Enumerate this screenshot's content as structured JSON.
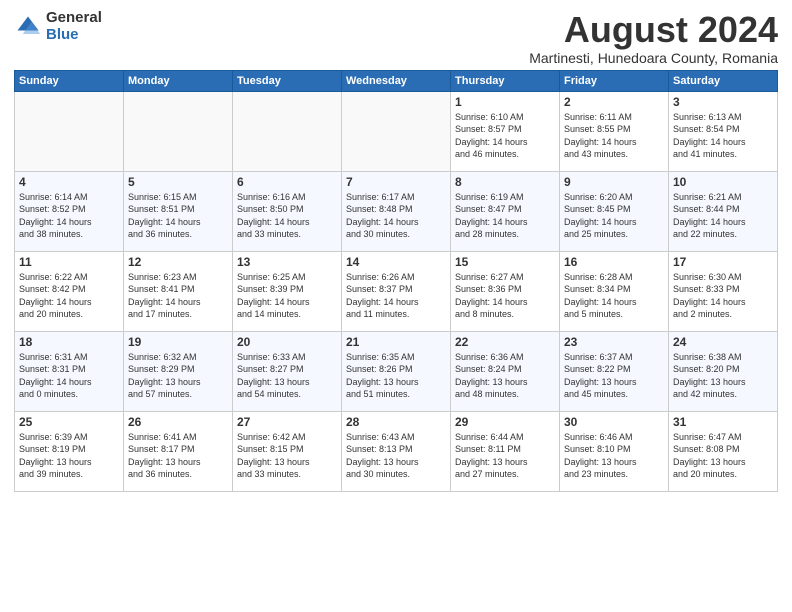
{
  "header": {
    "logo_general": "General",
    "logo_blue": "Blue",
    "title": "August 2024",
    "location": "Martinesti, Hunedoara County, Romania"
  },
  "weekdays": [
    "Sunday",
    "Monday",
    "Tuesday",
    "Wednesday",
    "Thursday",
    "Friday",
    "Saturday"
  ],
  "weeks": [
    [
      {
        "day": "",
        "detail": ""
      },
      {
        "day": "",
        "detail": ""
      },
      {
        "day": "",
        "detail": ""
      },
      {
        "day": "",
        "detail": ""
      },
      {
        "day": "1",
        "detail": "Sunrise: 6:10 AM\nSunset: 8:57 PM\nDaylight: 14 hours\nand 46 minutes."
      },
      {
        "day": "2",
        "detail": "Sunrise: 6:11 AM\nSunset: 8:55 PM\nDaylight: 14 hours\nand 43 minutes."
      },
      {
        "day": "3",
        "detail": "Sunrise: 6:13 AM\nSunset: 8:54 PM\nDaylight: 14 hours\nand 41 minutes."
      }
    ],
    [
      {
        "day": "4",
        "detail": "Sunrise: 6:14 AM\nSunset: 8:52 PM\nDaylight: 14 hours\nand 38 minutes."
      },
      {
        "day": "5",
        "detail": "Sunrise: 6:15 AM\nSunset: 8:51 PM\nDaylight: 14 hours\nand 36 minutes."
      },
      {
        "day": "6",
        "detail": "Sunrise: 6:16 AM\nSunset: 8:50 PM\nDaylight: 14 hours\nand 33 minutes."
      },
      {
        "day": "7",
        "detail": "Sunrise: 6:17 AM\nSunset: 8:48 PM\nDaylight: 14 hours\nand 30 minutes."
      },
      {
        "day": "8",
        "detail": "Sunrise: 6:19 AM\nSunset: 8:47 PM\nDaylight: 14 hours\nand 28 minutes."
      },
      {
        "day": "9",
        "detail": "Sunrise: 6:20 AM\nSunset: 8:45 PM\nDaylight: 14 hours\nand 25 minutes."
      },
      {
        "day": "10",
        "detail": "Sunrise: 6:21 AM\nSunset: 8:44 PM\nDaylight: 14 hours\nand 22 minutes."
      }
    ],
    [
      {
        "day": "11",
        "detail": "Sunrise: 6:22 AM\nSunset: 8:42 PM\nDaylight: 14 hours\nand 20 minutes."
      },
      {
        "day": "12",
        "detail": "Sunrise: 6:23 AM\nSunset: 8:41 PM\nDaylight: 14 hours\nand 17 minutes."
      },
      {
        "day": "13",
        "detail": "Sunrise: 6:25 AM\nSunset: 8:39 PM\nDaylight: 14 hours\nand 14 minutes."
      },
      {
        "day": "14",
        "detail": "Sunrise: 6:26 AM\nSunset: 8:37 PM\nDaylight: 14 hours\nand 11 minutes."
      },
      {
        "day": "15",
        "detail": "Sunrise: 6:27 AM\nSunset: 8:36 PM\nDaylight: 14 hours\nand 8 minutes."
      },
      {
        "day": "16",
        "detail": "Sunrise: 6:28 AM\nSunset: 8:34 PM\nDaylight: 14 hours\nand 5 minutes."
      },
      {
        "day": "17",
        "detail": "Sunrise: 6:30 AM\nSunset: 8:33 PM\nDaylight: 14 hours\nand 2 minutes."
      }
    ],
    [
      {
        "day": "18",
        "detail": "Sunrise: 6:31 AM\nSunset: 8:31 PM\nDaylight: 14 hours\nand 0 minutes."
      },
      {
        "day": "19",
        "detail": "Sunrise: 6:32 AM\nSunset: 8:29 PM\nDaylight: 13 hours\nand 57 minutes."
      },
      {
        "day": "20",
        "detail": "Sunrise: 6:33 AM\nSunset: 8:27 PM\nDaylight: 13 hours\nand 54 minutes."
      },
      {
        "day": "21",
        "detail": "Sunrise: 6:35 AM\nSunset: 8:26 PM\nDaylight: 13 hours\nand 51 minutes."
      },
      {
        "day": "22",
        "detail": "Sunrise: 6:36 AM\nSunset: 8:24 PM\nDaylight: 13 hours\nand 48 minutes."
      },
      {
        "day": "23",
        "detail": "Sunrise: 6:37 AM\nSunset: 8:22 PM\nDaylight: 13 hours\nand 45 minutes."
      },
      {
        "day": "24",
        "detail": "Sunrise: 6:38 AM\nSunset: 8:20 PM\nDaylight: 13 hours\nand 42 minutes."
      }
    ],
    [
      {
        "day": "25",
        "detail": "Sunrise: 6:39 AM\nSunset: 8:19 PM\nDaylight: 13 hours\nand 39 minutes."
      },
      {
        "day": "26",
        "detail": "Sunrise: 6:41 AM\nSunset: 8:17 PM\nDaylight: 13 hours\nand 36 minutes."
      },
      {
        "day": "27",
        "detail": "Sunrise: 6:42 AM\nSunset: 8:15 PM\nDaylight: 13 hours\nand 33 minutes."
      },
      {
        "day": "28",
        "detail": "Sunrise: 6:43 AM\nSunset: 8:13 PM\nDaylight: 13 hours\nand 30 minutes."
      },
      {
        "day": "29",
        "detail": "Sunrise: 6:44 AM\nSunset: 8:11 PM\nDaylight: 13 hours\nand 27 minutes."
      },
      {
        "day": "30",
        "detail": "Sunrise: 6:46 AM\nSunset: 8:10 PM\nDaylight: 13 hours\nand 23 minutes."
      },
      {
        "day": "31",
        "detail": "Sunrise: 6:47 AM\nSunset: 8:08 PM\nDaylight: 13 hours\nand 20 minutes."
      }
    ]
  ]
}
